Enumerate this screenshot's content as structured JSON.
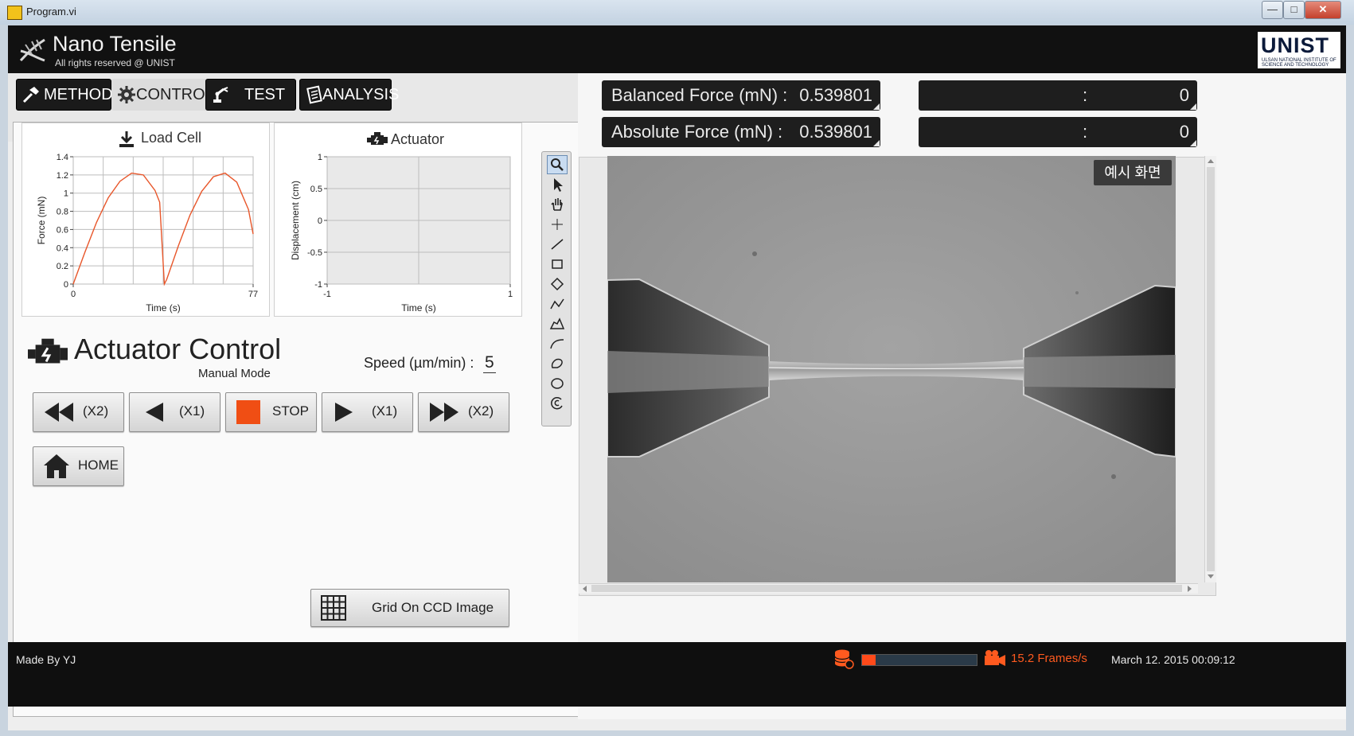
{
  "window": {
    "title": "Program.vi",
    "minimize_glyph": "—",
    "maximize_glyph": "□",
    "close_glyph": "✕"
  },
  "header": {
    "app_title": "Nano Tensile",
    "app_subtitle": "All rights reserved @ UNIST",
    "logo_text": "UNIST",
    "logo_subtext": "ULSAN NATIONAL INSTITUTE OF SCIENCE AND TECHNOLOGY"
  },
  "tabs": [
    {
      "label": "METHOD",
      "icon": "hammer-icon",
      "active": false
    },
    {
      "label": "CONTROL",
      "icon": "gear-icon",
      "active": true
    },
    {
      "label": "TEST",
      "icon": "robot-arm-icon",
      "active": false
    },
    {
      "label": "ANALYSIS",
      "icon": "notepad-icon",
      "active": false
    }
  ],
  "charts": {
    "load_cell_title": "Load Cell",
    "actuator_title": "Actuator"
  },
  "chart_data": [
    {
      "type": "line",
      "title": "Load Cell",
      "xlabel": "Time (s)",
      "ylabel": "Force (mN)",
      "xlim": [
        0,
        77
      ],
      "ylim": [
        0,
        1.4
      ],
      "x_ticks": [
        "0",
        "77"
      ],
      "y_ticks": [
        "0",
        "0.2",
        "0.4",
        "0.6",
        "0.8",
        "1",
        "1.2",
        "1.4"
      ],
      "grid": true,
      "series": [
        {
          "color": "#e8562a",
          "x": [
            0,
            5,
            10,
            15,
            20,
            25,
            30,
            35,
            37,
            39,
            40,
            45,
            50,
            55,
            60,
            65,
            70,
            75,
            77
          ],
          "y": [
            0.0,
            0.35,
            0.68,
            0.95,
            1.13,
            1.22,
            1.2,
            1.03,
            0.9,
            0.0,
            0.05,
            0.42,
            0.76,
            1.02,
            1.18,
            1.22,
            1.12,
            0.82,
            0.55
          ]
        }
      ]
    },
    {
      "type": "line",
      "title": "Actuator",
      "xlabel": "Time (s)",
      "ylabel": "Displacement (cm)",
      "xlim": [
        -1,
        1
      ],
      "ylim": [
        -1,
        1
      ],
      "x_ticks": [
        "-1",
        "1"
      ],
      "y_ticks": [
        "-1",
        "-0.5",
        "0",
        "0.5",
        "1"
      ],
      "grid": true,
      "series": []
    }
  ],
  "actuator_control": {
    "title": "Actuator Control",
    "mode": "Manual Mode",
    "speed_label": "Speed (µm/min) :",
    "speed_value": "5",
    "buttons": {
      "back_x2": "(X2)",
      "back_x1": "(X1)",
      "stop": "STOP",
      "fwd_x1": "(X1)",
      "fwd_x2": "(X2)",
      "home": "HOME"
    },
    "grid_button": "Grid On CCD Image",
    "stop_color": "#f04e14"
  },
  "indicators": {
    "balanced_label": "Balanced Force (mN) :",
    "balanced_value": "0.539801",
    "absolute_label": "Absolute Force (mN) :",
    "absolute_value": "0.539801",
    "right1_label": ":",
    "right1_value": "0",
    "right2_label": ":",
    "right2_value": "0"
  },
  "viewer": {
    "badge": "예시 화면",
    "tools": [
      "zoom-icon",
      "pointer-icon",
      "pan-hand-icon",
      "crosshair-icon",
      "line-icon",
      "rectangle-icon",
      "rotated-rect-icon",
      "polyline-icon",
      "polygon-icon",
      "freeline-icon",
      "freehand-icon",
      "oval-icon",
      "annulus-icon"
    ]
  },
  "statusbar": {
    "made_by": "Made By YJ",
    "progress_fraction": 0.12,
    "fps": "15.2 Frames/s",
    "datetime": "March 12. 2015 00:09:12"
  }
}
